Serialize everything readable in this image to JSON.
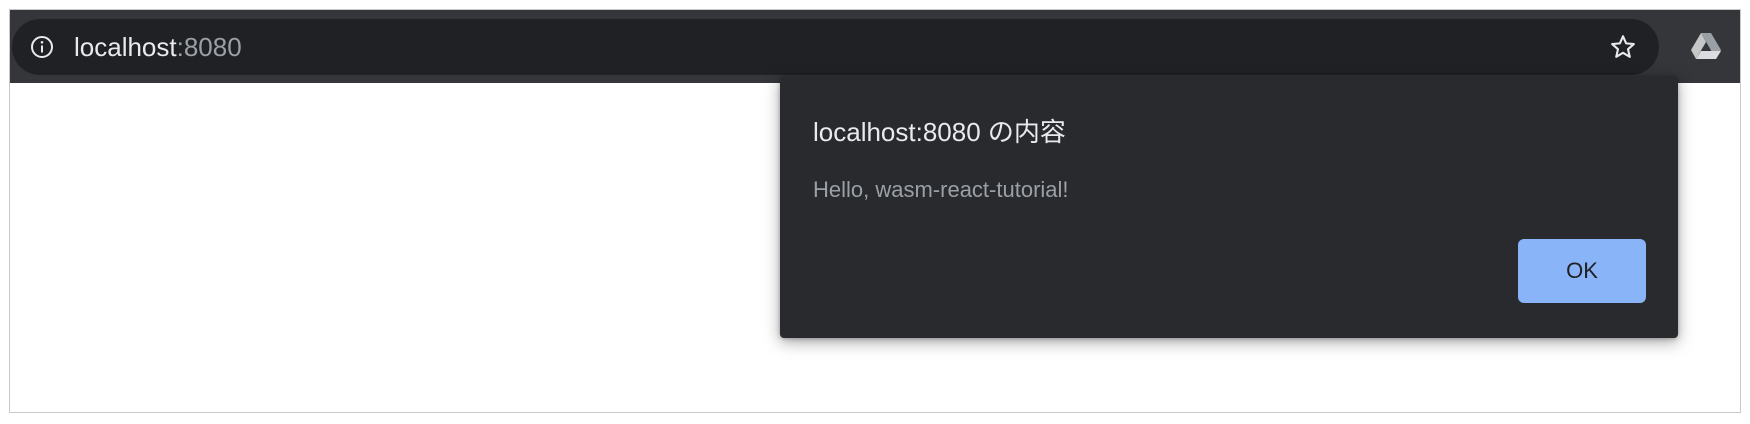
{
  "omnibox": {
    "url_host": "localhost",
    "url_port": ":8080",
    "info_icon": "info-icon",
    "bookmark_icon": "star-icon"
  },
  "extension": {
    "icon": "google-drive-icon"
  },
  "dialog": {
    "title": "localhost:8080 の内容",
    "message": "Hello, wasm-react-tutorial!",
    "ok_label": "OK"
  },
  "colors": {
    "toolbar_bg": "#35363a",
    "omnibox_bg": "#202124",
    "dialog_bg": "#292a2d",
    "button_bg": "#8ab4f8",
    "text_primary": "#e8eaed",
    "text_secondary": "#9aa0a6"
  }
}
